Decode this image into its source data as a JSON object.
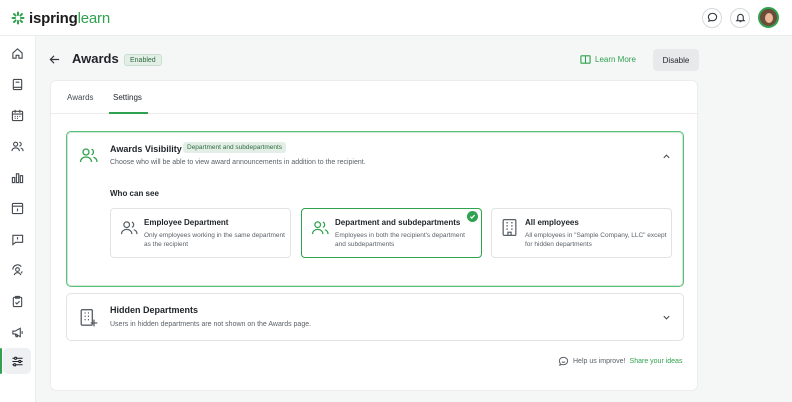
{
  "brand": {
    "name_part1": "ispring",
    "name_part2": "learn",
    "accent": "#2fa24f"
  },
  "topbar": {
    "icons": [
      "chat-icon",
      "bell-icon",
      "user-avatar"
    ]
  },
  "sidebar": {
    "items": [
      {
        "icon": "home-icon"
      },
      {
        "icon": "book-icon"
      },
      {
        "icon": "calendar-icon"
      },
      {
        "icon": "users-icon"
      },
      {
        "icon": "bar-chart-icon"
      },
      {
        "icon": "archive-icon"
      },
      {
        "icon": "message-alert-icon"
      },
      {
        "icon": "user-sync-icon"
      },
      {
        "icon": "clipboard-check-icon"
      },
      {
        "icon": "megaphone-icon"
      },
      {
        "icon": "sliders-icon",
        "active": true
      }
    ]
  },
  "header": {
    "title": "Awards",
    "status_badge": "Enabled",
    "learn_more": "Learn More",
    "disable": "Disable"
  },
  "tabs": [
    {
      "label": "Awards",
      "active": false
    },
    {
      "label": "Settings",
      "active": true
    }
  ],
  "visibility": {
    "title": "Awards Visibility",
    "badge": "Department and subdepartments",
    "description": "Choose who will be able to view award announcements in addition to the recipient.",
    "who_label": "Who can see",
    "options": [
      {
        "title": "Employee Department",
        "desc": "Only employees working in the same department as the recipient",
        "selected": false,
        "icon": "users-icon"
      },
      {
        "title": "Department and subdepartments",
        "desc": "Employees in both the recipient's department and subdepartments",
        "selected": true,
        "icon": "users-icon"
      },
      {
        "title": "All employees",
        "desc": "All employees in \"Sample Company, LLC\" except for hidden departments",
        "selected": false,
        "icon": "building-icon"
      }
    ]
  },
  "hidden": {
    "title": "Hidden Departments",
    "description": "Users in hidden departments are not shown on the Awards page."
  },
  "help": {
    "text": "Help us improve!",
    "link": "Share your ideas"
  }
}
